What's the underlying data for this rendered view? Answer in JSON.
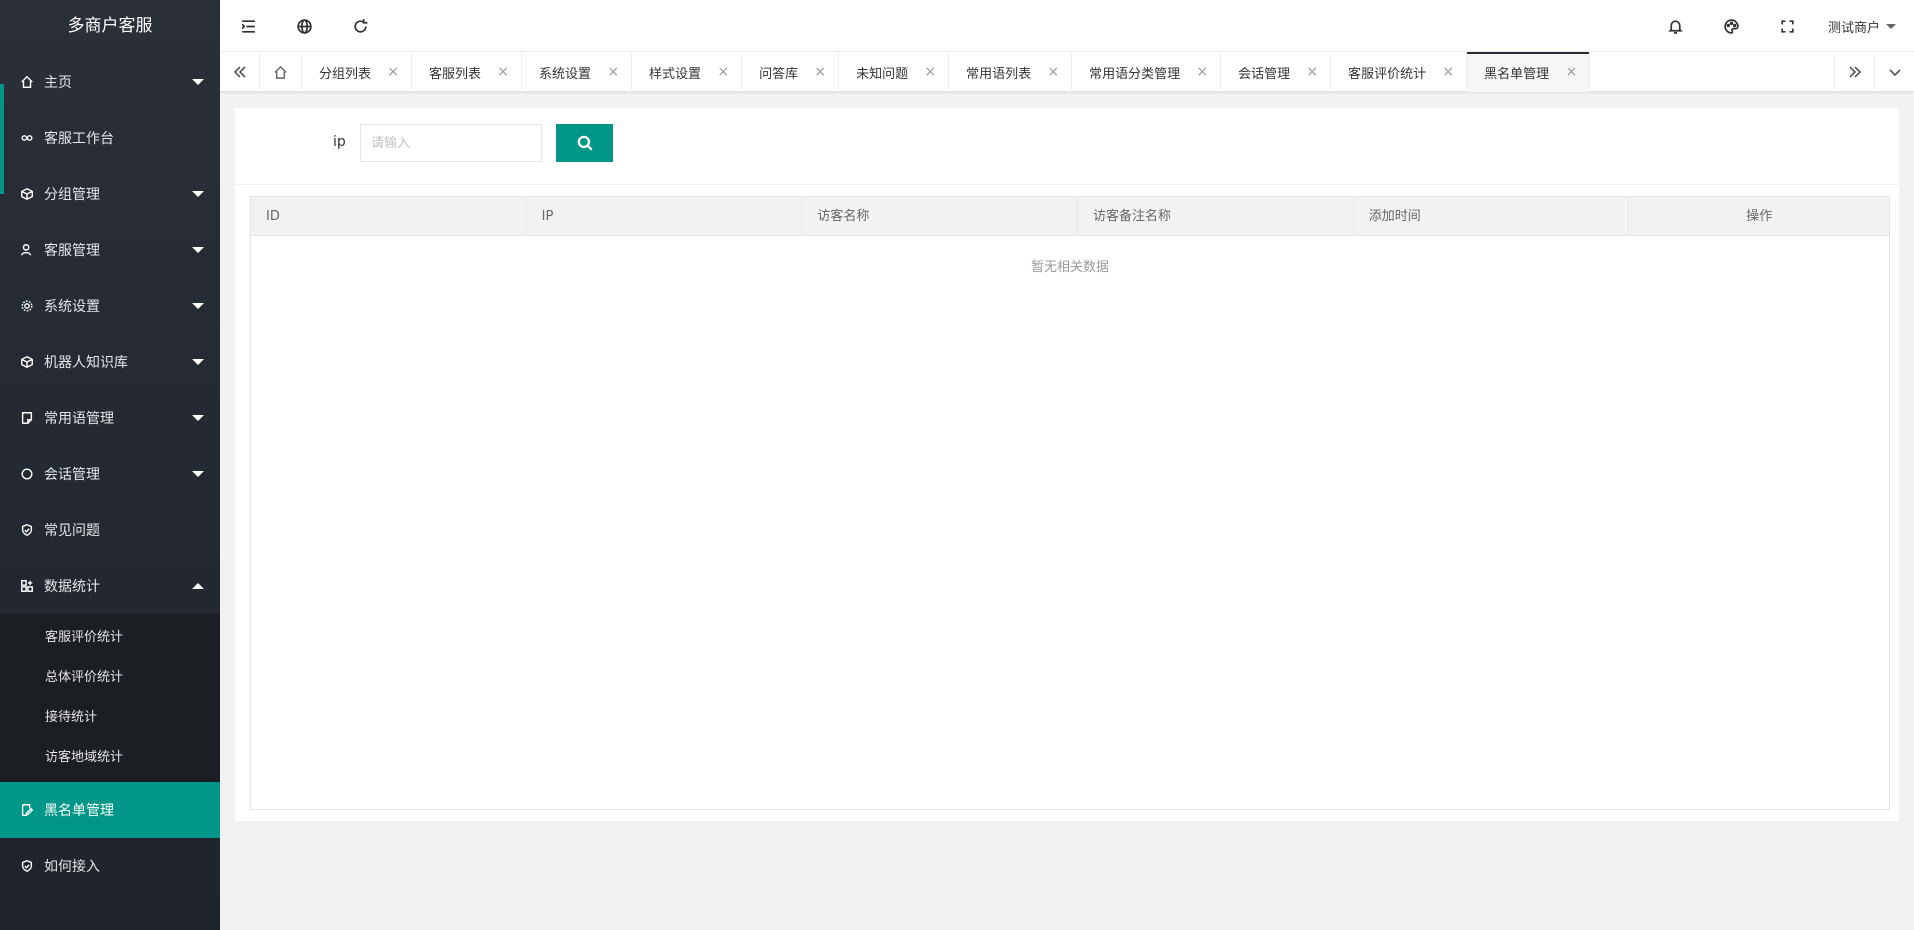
{
  "sidebar": {
    "title": "多商户客服",
    "items": [
      {
        "label": "主页"
      },
      {
        "label": "客服工作台"
      },
      {
        "label": "分组管理"
      },
      {
        "label": "客服管理"
      },
      {
        "label": "系统设置"
      },
      {
        "label": "机器人知识库"
      },
      {
        "label": "常用语管理"
      },
      {
        "label": "会话管理"
      },
      {
        "label": "常见问题"
      },
      {
        "label": "数据统计"
      },
      {
        "label": "黑名单管理"
      },
      {
        "label": "如何接入"
      }
    ],
    "submenu": [
      "客服评价统计",
      "总体评价统计",
      "接待统计",
      "访客地域统计"
    ]
  },
  "header": {
    "user": "测试商户"
  },
  "tabs": [
    "分组列表",
    "客服列表",
    "系统设置",
    "样式设置",
    "问答库",
    "未知问题",
    "常用语列表",
    "常用语分类管理",
    "会话管理",
    "客服评价统计",
    "黑名单管理"
  ],
  "search": {
    "label": "ip",
    "placeholder": "请输入"
  },
  "table": {
    "columns": [
      "ID",
      "IP",
      "访客名称",
      "访客备注名称",
      "添加时间",
      "操作"
    ],
    "empty_text": "暂无相关数据"
  },
  "colors": {
    "accent": "#009688",
    "sidebar_bg": "#28333e"
  }
}
